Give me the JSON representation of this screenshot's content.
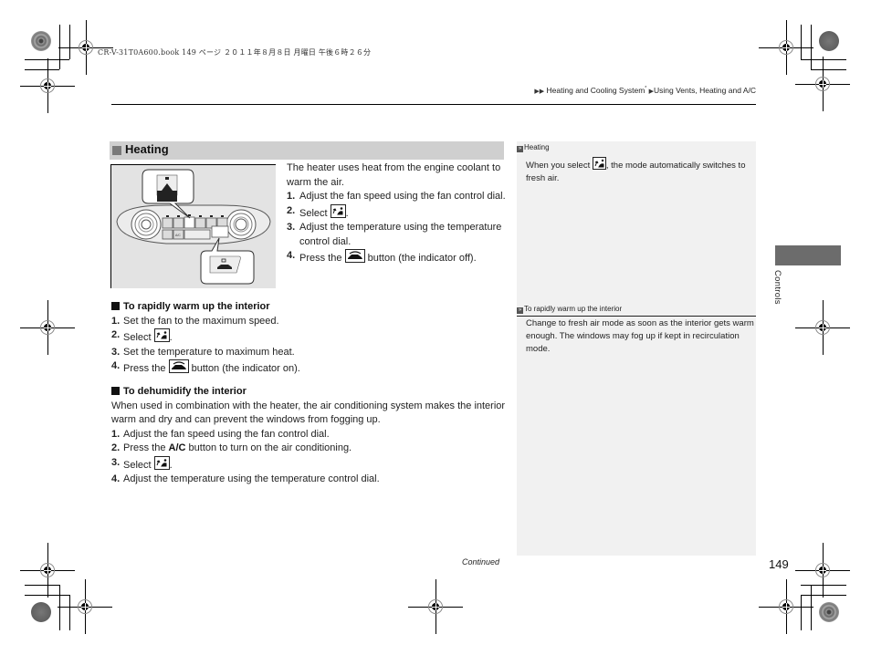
{
  "print_header": {
    "file_info": "CR-V-31T0A600.book  149 ページ  ２０１１年８月８日  月曜日  午後６時２６分"
  },
  "breadcrumb": {
    "items": [
      "Heating and Cooling System",
      "Using Vents, Heating and A/C"
    ],
    "footnote_mark": "*"
  },
  "section": {
    "title": "Heating",
    "intro": "The heater uses heat from the engine coolant to warm the air.",
    "steps": [
      {
        "num": "1.",
        "text": "Adjust the fan speed using the fan control dial."
      },
      {
        "num": "2.",
        "pre": "Select",
        "icon": "floor-vent-mode-icon",
        "post": "."
      },
      {
        "num": "3.",
        "text": "Adjust the temperature using the temperature control dial."
      },
      {
        "num": "4.",
        "pre": "Press the",
        "icon": "recirculation-icon",
        "post": "button (the indicator off)."
      }
    ]
  },
  "warm_up": {
    "title": "To rapidly warm up the interior",
    "steps": [
      {
        "num": "1.",
        "text": "Set the fan to the maximum speed."
      },
      {
        "num": "2.",
        "pre": "Select",
        "icon": "floor-vent-mode-icon",
        "post": "."
      },
      {
        "num": "3.",
        "text": "Set the temperature to maximum heat."
      },
      {
        "num": "4.",
        "pre": "Press the",
        "icon": "recirculation-icon",
        "post": "button (the indicator on)."
      }
    ]
  },
  "dehumidify": {
    "title": "To dehumidify the interior",
    "intro": "When used in combination with the heater, the air conditioning system makes the interior warm and dry and can prevent the windows from fogging up.",
    "steps": [
      {
        "num": "1.",
        "text": "Adjust the fan speed using the fan control dial."
      },
      {
        "num": "2.",
        "pre": "Press the",
        "bold": "A/C",
        "post": "button to turn on the air conditioning."
      },
      {
        "num": "3.",
        "pre": "Select",
        "icon": "floor-vent-mode-icon",
        "post": "."
      },
      {
        "num": "4.",
        "text": "Adjust the temperature using the temperature control dial."
      }
    ]
  },
  "sidebar": {
    "notes": [
      {
        "heading": "Heating",
        "pre": "When you select",
        "icon": "floor-vent-mode-icon",
        "post": ", the mode automatically switches to fresh air."
      },
      {
        "heading": "To rapidly warm up the interior",
        "text": "Change to fresh air mode as soon as the interior gets warm enough. The windows may fog up if kept in recirculation mode."
      }
    ]
  },
  "chapter_tab": {
    "label": "Controls"
  },
  "footer": {
    "continued": "Continued",
    "page_number": "149"
  },
  "illustration": {
    "panel_labels": [
      "A/C"
    ]
  }
}
